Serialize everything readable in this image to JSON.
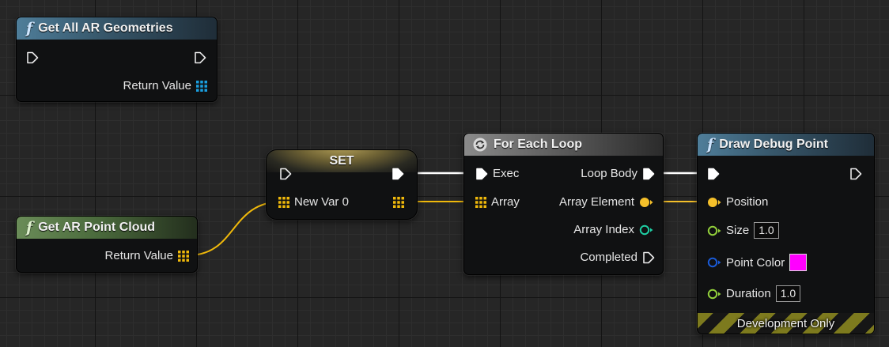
{
  "nodes": {
    "get_all_ar_geometries": {
      "title": "Get All AR Geometries",
      "return_label": "Return Value"
    },
    "get_ar_point_cloud": {
      "title": "Get AR Point Cloud",
      "return_label": "Return Value"
    },
    "set": {
      "title": "SET",
      "var_label": "New Var 0"
    },
    "for_each_loop": {
      "title": "For Each Loop",
      "exec_label": "Exec",
      "array_label": "Array",
      "loop_body_label": "Loop Body",
      "array_element_label": "Array Element",
      "array_index_label": "Array Index",
      "completed_label": "Completed"
    },
    "draw_debug_point": {
      "title": "Draw Debug Point",
      "position_label": "Position",
      "size_label": "Size",
      "size_value": "1.0",
      "point_color_label": "Point Color",
      "point_color": "#ff00ff",
      "duration_label": "Duration",
      "duration_value": "1.0",
      "footer": "Development Only"
    }
  },
  "colors": {
    "exec": "#ffffff",
    "array_blue": "#1a9fe0",
    "array_yellow": "#f0b90b",
    "struct_yellow": "#f5c02a",
    "float_green": "#93d13b",
    "int_teal": "#1fcfa4",
    "color_struct_blue": "#1a5bd8"
  }
}
